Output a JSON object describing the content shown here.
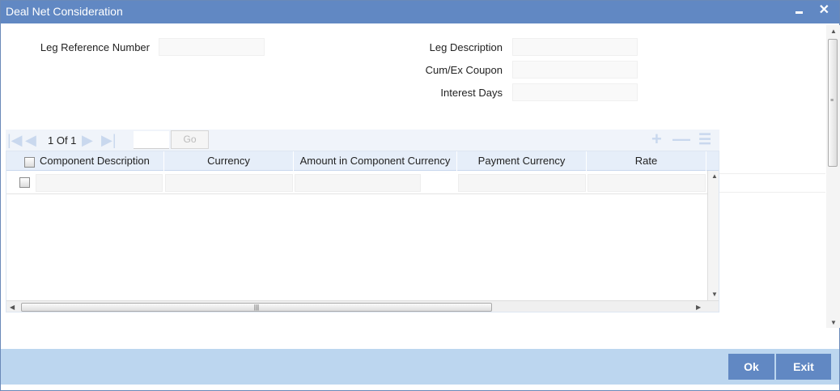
{
  "window": {
    "title": "Deal Net Consideration",
    "minimize_icon": "minimize-icon",
    "close_icon": "close-icon"
  },
  "form": {
    "leg_reference_number_label": "Leg Reference Number",
    "leg_reference_number_value": "",
    "leg_description_label": "Leg Description",
    "leg_description_value": "",
    "cum_ex_coupon_label": "Cum/Ex Coupon",
    "cum_ex_coupon_value": "",
    "interest_days_label": "Interest Days",
    "interest_days_value": ""
  },
  "pager": {
    "page_text": "1 Of 1",
    "page_input_value": "",
    "go_label": "Go",
    "icons": [
      "first-page-icon",
      "prev-page-icon",
      "next-page-icon",
      "last-page-icon",
      "add-row-icon",
      "delete-row-icon",
      "view-icon"
    ]
  },
  "grid": {
    "columns": [
      "Component Description",
      "Currency",
      "Amount in Component Currency",
      "Payment Currency",
      "Rate"
    ],
    "rows": [
      [
        "",
        "",
        "",
        "",
        ""
      ]
    ]
  },
  "footer": {
    "ok_label": "Ok",
    "exit_label": "Exit"
  },
  "colors": {
    "title_bar": "#6188c3",
    "footer": "#bcd6ef",
    "button": "#6188c3",
    "grid_header": "#e6eef9"
  }
}
